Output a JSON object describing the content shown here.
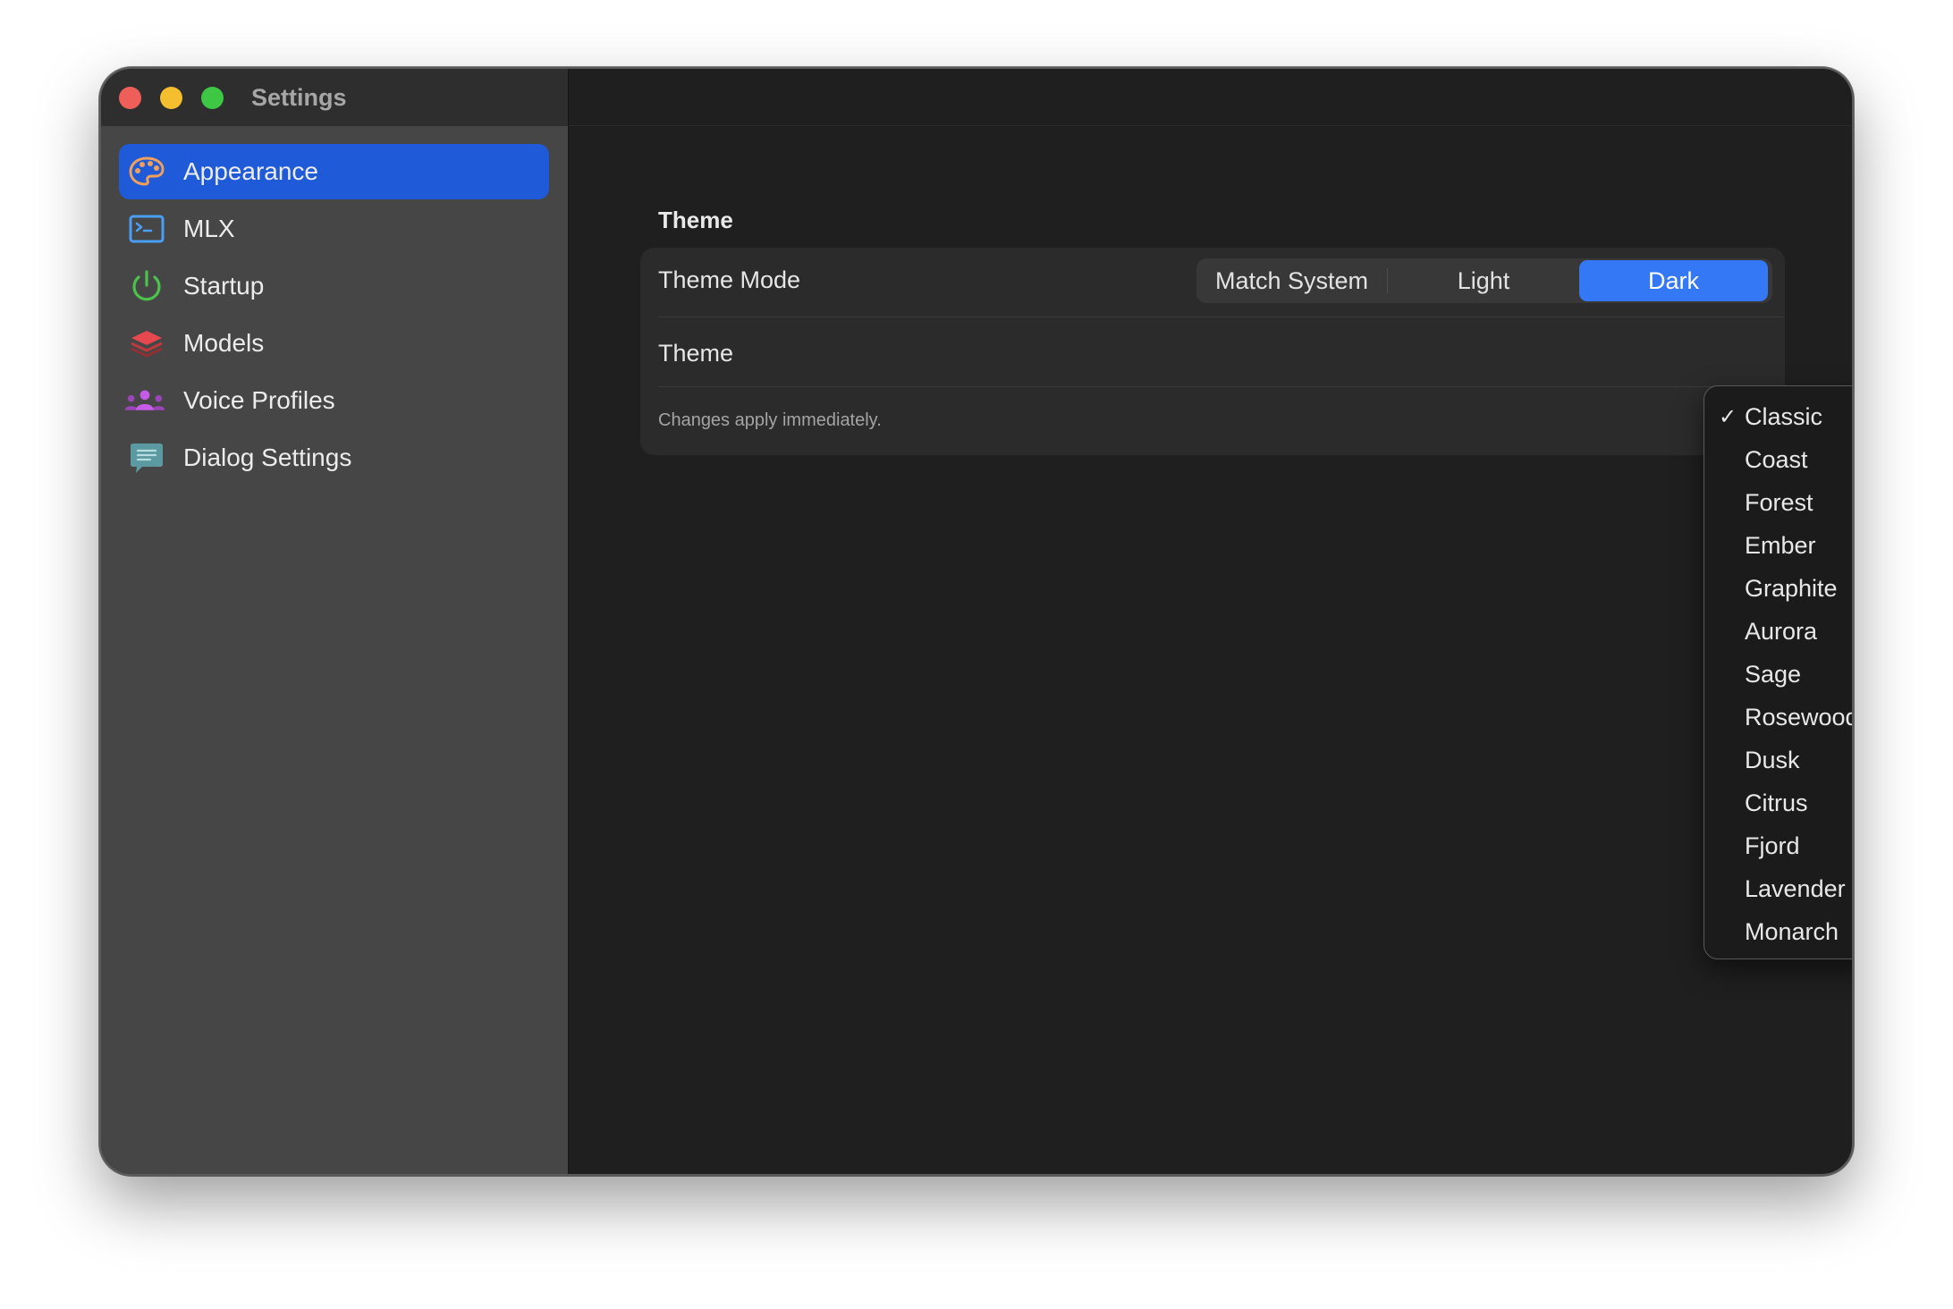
{
  "window": {
    "title": "Settings"
  },
  "sidebar": {
    "items": [
      {
        "label": "Appearance",
        "icon": "palette-icon",
        "active": true
      },
      {
        "label": "MLX",
        "icon": "terminal-icon",
        "active": false
      },
      {
        "label": "Startup",
        "icon": "power-icon",
        "active": false
      },
      {
        "label": "Models",
        "icon": "layers-icon",
        "active": false
      },
      {
        "label": "Voice Profiles",
        "icon": "people-icon",
        "active": false
      },
      {
        "label": "Dialog Settings",
        "icon": "chat-bubble-icon",
        "active": false
      }
    ]
  },
  "main": {
    "section_title": "Theme",
    "theme_mode": {
      "label": "Theme Mode",
      "options": [
        "Match System",
        "Light",
        "Dark"
      ],
      "selected": "Dark"
    },
    "theme": {
      "label": "Theme"
    },
    "hint": "Changes apply immediately."
  },
  "theme_menu": {
    "selected": "Classic",
    "check": "✓",
    "items": [
      "Classic",
      "Coast",
      "Forest",
      "Ember",
      "Graphite",
      "Aurora",
      "Sage",
      "Rosewood",
      "Dusk",
      "Citrus",
      "Fjord",
      "Lavender Mist",
      "Monarch"
    ]
  },
  "colors": {
    "accent": "#3478f6",
    "sidebar_active": "#1f5bd8",
    "palette_icon": "#f0a05a",
    "terminal_icon": "#4a9ff5",
    "power_icon": "#4cc24c",
    "layers_icon": "#e5484d",
    "people_icon": "#b64fd6",
    "chat_icon": "#5a9aa0"
  }
}
